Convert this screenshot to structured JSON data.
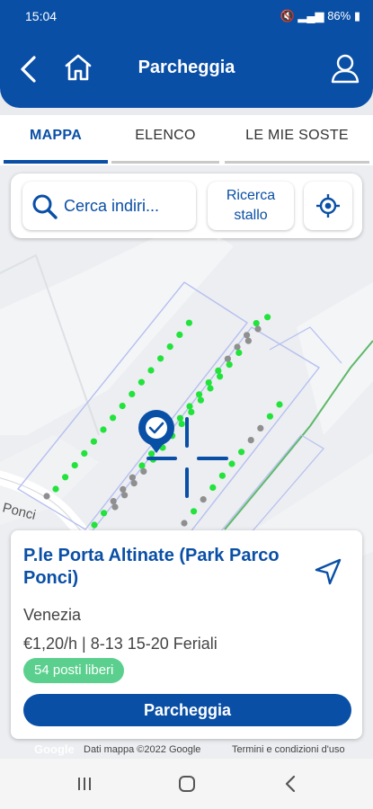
{
  "status": {
    "time": "15:04",
    "battery": "86%"
  },
  "header": {
    "title": "Parcheggia"
  },
  "tabs": [
    {
      "label": "MAPPA",
      "active": true
    },
    {
      "label": "ELENCO",
      "active": false
    },
    {
      "label": "LE MIE SOSTE",
      "active": false
    }
  ],
  "search": {
    "placeholder": "Cerca indiri...",
    "stall_label_1": "Ricerca",
    "stall_label_2": "stallo"
  },
  "map": {
    "street_label": "Ponci",
    "free_color": "#22e33c",
    "occupied_color": "#8f8f8f"
  },
  "card": {
    "name": "P.le Porta Altinate (Park Parco Ponci)",
    "city": "Venezia",
    "rate": "€1,20/h | 8-13 15-20 Feriali",
    "free_spots": "54 posti liberi",
    "action": "Parcheggia"
  },
  "attribution": {
    "logo": "Google",
    "data": "Dati mappa ©2022 Google",
    "terms": "Termini e condizioni d'uso"
  },
  "colors": {
    "primary": "#0a4fa6",
    "badge": "#5bd08e"
  }
}
